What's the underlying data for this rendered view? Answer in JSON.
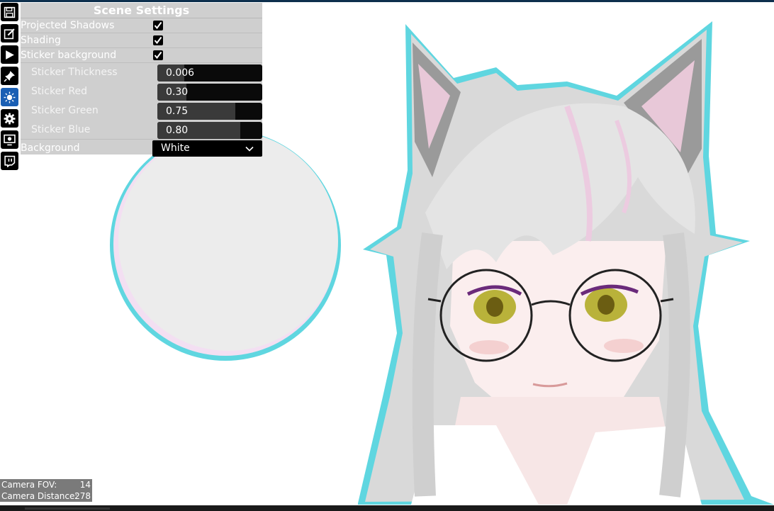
{
  "toolbar": {
    "icons": [
      "save-icon",
      "edit-icon",
      "play-icon",
      "pin-icon",
      "sun-icon",
      "gear-icon",
      "display-settings-icon",
      "twitch-icon"
    ],
    "active": "sun-icon"
  },
  "panel": {
    "title": "Scene Settings",
    "checkboxes": [
      {
        "label": "Projected Shadows",
        "checked": true
      },
      {
        "label": "Shading",
        "checked": true
      },
      {
        "label": "Sticker background",
        "checked": true
      }
    ],
    "sliders": [
      {
        "label": "Sticker Thickness",
        "value": "0.006",
        "level": 0.26
      },
      {
        "label": "Sticker Red",
        "value": "0.30",
        "level": 0.28
      },
      {
        "label": "Sticker Green",
        "value": "0.75",
        "level": 0.74
      },
      {
        "label": "Sticker Blue",
        "value": "0.80",
        "level": 0.79
      }
    ],
    "background": {
      "label": "Background",
      "value": "White"
    }
  },
  "camera": {
    "fov_label": "Camera FOV:",
    "fov_value": "14",
    "distance_label": "Camera Distance:",
    "distance_value": "278"
  },
  "colors": {
    "sticker_outline": "#5fd6e0",
    "active_tool": "#1a5fb4",
    "panel": "#cfcfcf"
  }
}
